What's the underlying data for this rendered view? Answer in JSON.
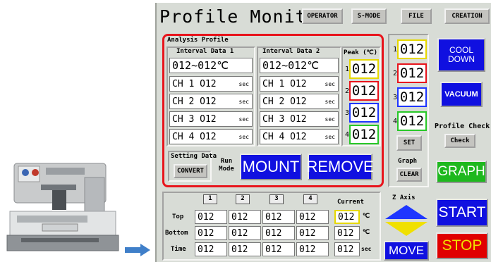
{
  "header": {
    "title": "Profile Monitor",
    "tabs": [
      "OPERATOR",
      "S-MODE",
      "FILE",
      "CREATION"
    ]
  },
  "analysis": {
    "title": "Analysis Profile",
    "interval1": {
      "label": "Interval Data 1",
      "range": "012~012℃",
      "channels": [
        "CH 1 O12",
        "CH 2 O12",
        "CH 3 O12",
        "CH 4 O12"
      ],
      "unit": "sec"
    },
    "interval2": {
      "label": "Interval Data 2",
      "range": "012~012℃",
      "channels": [
        "CH 1 O12",
        "CH 2 O12",
        "CH 3 O12",
        "CH 4 O12"
      ],
      "unit": "sec"
    },
    "peak": {
      "label": "Peak (℃)",
      "values": [
        "012",
        "012",
        "012",
        "012"
      ],
      "numbers": [
        "1",
        "2",
        "3",
        "4"
      ]
    },
    "setting": {
      "label": "Setting Data",
      "convert": "CONVERT"
    },
    "run_mode": "Run Mode",
    "mount": "MOUNT",
    "remove": "REMOVE"
  },
  "right_column": {
    "values": [
      "012",
      "012",
      "012",
      "012"
    ],
    "numbers": [
      "1",
      "2",
      "3",
      "4"
    ],
    "set": "SET",
    "graph_label": "Graph",
    "clear": "CLEAR"
  },
  "buttons": {
    "cool_down": "COOL DOWN",
    "vacuum": "VACUUM",
    "profile_check_label": "Profile Check",
    "check": "Check",
    "graph": "GRAPH",
    "start": "START",
    "stop": "STOP",
    "move": "MOVE"
  },
  "bottom": {
    "col_headers": [
      "1",
      "2",
      "3",
      "4"
    ],
    "current_label": "Current",
    "rows": [
      {
        "label": "Top",
        "values": [
          "012",
          "012",
          "012",
          "012"
        ],
        "current": "012",
        "unit": "℃"
      },
      {
        "label": "Bottom",
        "values": [
          "012",
          "012",
          "012",
          "012"
        ],
        "current": "012",
        "unit": "℃"
      },
      {
        "label": "Time",
        "values": [
          "012",
          "012",
          "012",
          "012"
        ],
        "current": "012",
        "unit": "sec"
      }
    ],
    "z_axis": "Z Axis"
  },
  "colors": {
    "highlight_border": "#e8141c",
    "peak_borders": [
      "#e6d800",
      "#e8141c",
      "#1e36ff",
      "#28c828"
    ],
    "blue_button": "#1010e0",
    "green_button": "#1eb81e",
    "red_button": "#e00000",
    "yellow": "#f0e000"
  }
}
